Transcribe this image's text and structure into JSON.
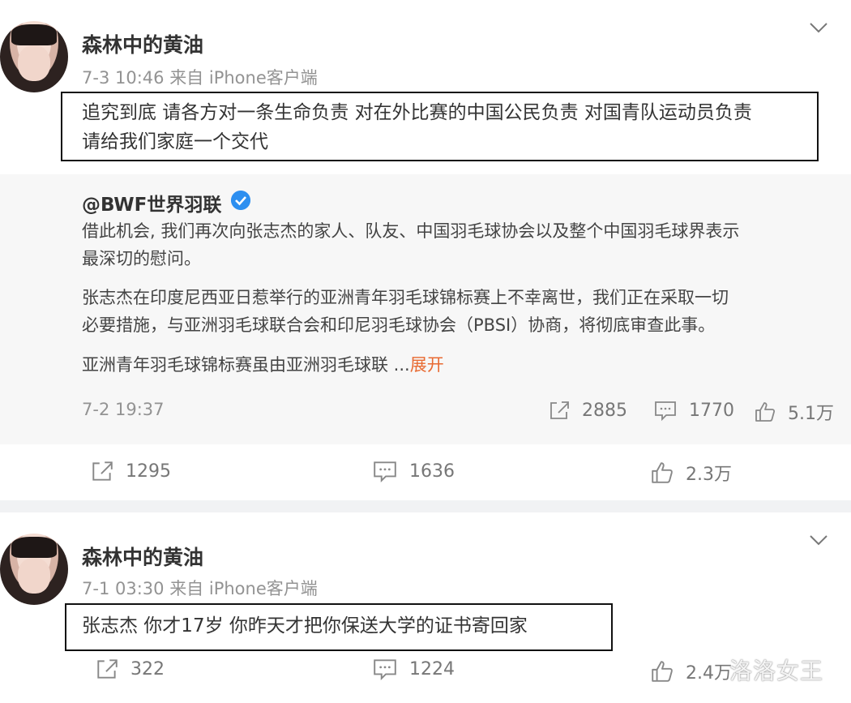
{
  "posts": [
    {
      "username": "森林中的黄油",
      "time": "7-3 10:46",
      "source": "来自 iPhone客户端",
      "content_line1": "追究到底 请各方对一条生命负责 对在外比赛的中国公民负责 对国青队运动员负责",
      "content_line2": "请给我们家庭一个交代",
      "repost": {
        "username": "@BWF世界羽联",
        "p1_line1": "借此机会, 我们再次向张志杰的家人、队友、中国羽毛球协会以及整个中国羽毛球界表示",
        "p1_line2": "最深切的慰问。",
        "p2_line1": "张志杰在印度尼西亚日惹举行的亚洲青年羽毛球锦标赛上不幸离世，我们正在采取一切",
        "p2_line2": "必要措施，与亚洲羽毛球联合会和印尼羽毛球协会（PBSI）协商，将彻底审查此事。",
        "p3": "亚洲青年羽毛球锦标赛虽由亚洲羽毛球联 ...",
        "expand_label": "展开",
        "date": "7-2 19:37",
        "shares": "2885",
        "comments": "1770",
        "likes": "5.1万"
      },
      "shares": "1295",
      "comments": "1636",
      "likes": "2.3万"
    },
    {
      "username": "森林中的黄油",
      "time": "7-1 03:30",
      "source": "来自 iPhone客户端",
      "content_line1": "张志杰 你才17岁 你昨天才把你保送大学的证书寄回家",
      "shares": "322",
      "comments": "1224",
      "likes": "2.4万"
    }
  ],
  "watermark": "洛洛女王",
  "colors": {
    "expand_link": "#e86a32",
    "verified_badge": "#2d8ff0",
    "divider": "#f1f2f4"
  },
  "icons": [
    "chevron-down-icon",
    "share-icon",
    "comment-icon",
    "like-icon",
    "verified-icon"
  ]
}
